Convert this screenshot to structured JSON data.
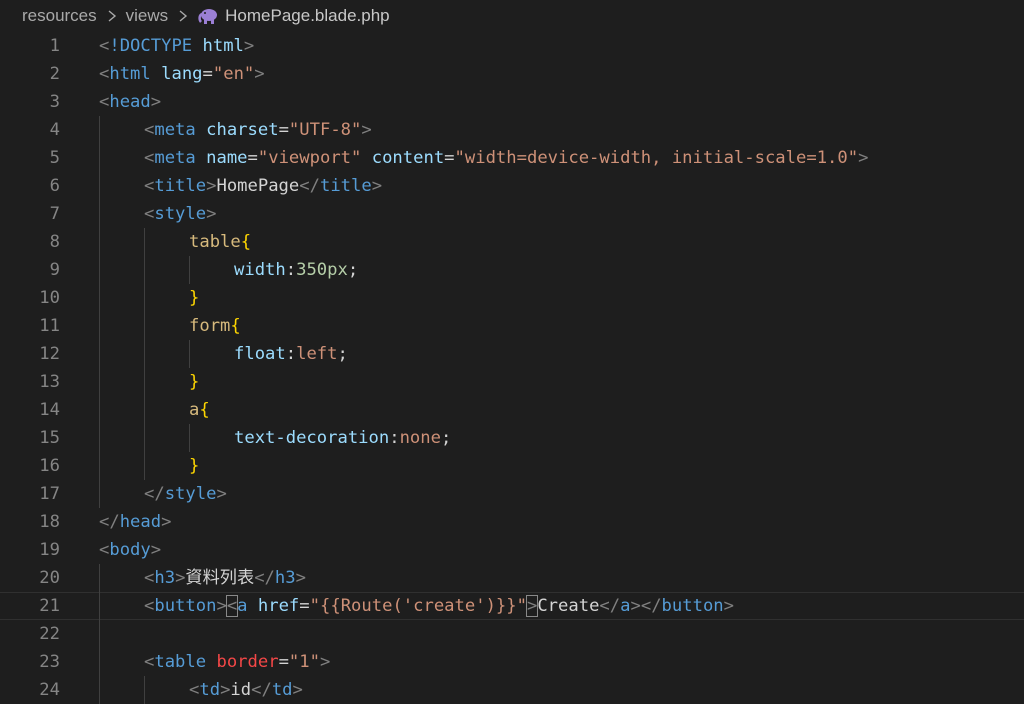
{
  "breadcrumb": {
    "parts": [
      "resources",
      "views"
    ],
    "file": "HomePage.blade.php",
    "file_icon": "php-elephant-icon"
  },
  "colors": {
    "background": "#1e1e1e",
    "tag": "#569cd6",
    "attribute": "#9cdcfe",
    "string": "#ce9178",
    "selector": "#d7ba7d",
    "number": "#b5cea8",
    "line_number": "#858585"
  },
  "current_line": 21,
  "lines": [
    {
      "n": "1",
      "indent": 0,
      "tokens": [
        [
          "pun",
          "<"
        ],
        [
          "tag",
          "!DOCTYPE"
        ],
        [
          "txt",
          " "
        ],
        [
          "attr",
          "html"
        ],
        [
          "pun",
          ">"
        ]
      ]
    },
    {
      "n": "2",
      "indent": 0,
      "tokens": [
        [
          "pun",
          "<"
        ],
        [
          "tag",
          "html"
        ],
        [
          "txt",
          " "
        ],
        [
          "attr",
          "lang"
        ],
        [
          "txt",
          "="
        ],
        [
          "str",
          "\"en\""
        ],
        [
          "pun",
          ">"
        ]
      ]
    },
    {
      "n": "3",
      "indent": 0,
      "tokens": [
        [
          "pun",
          "<"
        ],
        [
          "tag",
          "head"
        ],
        [
          "pun",
          ">"
        ]
      ]
    },
    {
      "n": "4",
      "indent": 1,
      "tokens": [
        [
          "pun",
          "<"
        ],
        [
          "tag",
          "meta"
        ],
        [
          "txt",
          " "
        ],
        [
          "attr",
          "charset"
        ],
        [
          "txt",
          "="
        ],
        [
          "str",
          "\"UTF-8\""
        ],
        [
          "pun",
          ">"
        ]
      ]
    },
    {
      "n": "5",
      "indent": 1,
      "tokens": [
        [
          "pun",
          "<"
        ],
        [
          "tag",
          "meta"
        ],
        [
          "txt",
          " "
        ],
        [
          "attr",
          "name"
        ],
        [
          "txt",
          "="
        ],
        [
          "str",
          "\"viewport\""
        ],
        [
          "txt",
          " "
        ],
        [
          "attr",
          "content"
        ],
        [
          "txt",
          "="
        ],
        [
          "str",
          "\"width=device-width, initial-scale=1.0\""
        ],
        [
          "pun",
          ">"
        ]
      ]
    },
    {
      "n": "6",
      "indent": 1,
      "tokens": [
        [
          "pun",
          "<"
        ],
        [
          "tag",
          "title"
        ],
        [
          "pun",
          ">"
        ],
        [
          "txt",
          "HomePage"
        ],
        [
          "pun",
          "</"
        ],
        [
          "tag",
          "title"
        ],
        [
          "pun",
          ">"
        ]
      ]
    },
    {
      "n": "7",
      "indent": 1,
      "tokens": [
        [
          "pun",
          "<"
        ],
        [
          "tag",
          "style"
        ],
        [
          "pun",
          ">"
        ]
      ]
    },
    {
      "n": "8",
      "indent": 2,
      "tokens": [
        [
          "sel",
          "table"
        ],
        [
          "brace",
          "{"
        ]
      ]
    },
    {
      "n": "9",
      "indent": 3,
      "tokens": [
        [
          "prop",
          "width"
        ],
        [
          "txt",
          ":"
        ],
        [
          "num",
          "350px"
        ],
        [
          "txt",
          ";"
        ]
      ]
    },
    {
      "n": "10",
      "indent": 2,
      "tokens": [
        [
          "brace",
          "}"
        ]
      ]
    },
    {
      "n": "11",
      "indent": 2,
      "tokens": [
        [
          "sel",
          "form"
        ],
        [
          "brace",
          "{"
        ]
      ]
    },
    {
      "n": "12",
      "indent": 3,
      "tokens": [
        [
          "prop",
          "float"
        ],
        [
          "txt",
          ":"
        ],
        [
          "val",
          "left"
        ],
        [
          "txt",
          ";"
        ]
      ]
    },
    {
      "n": "13",
      "indent": 2,
      "tokens": [
        [
          "brace",
          "}"
        ]
      ]
    },
    {
      "n": "14",
      "indent": 2,
      "tokens": [
        [
          "sel",
          "a"
        ],
        [
          "brace",
          "{"
        ]
      ]
    },
    {
      "n": "15",
      "indent": 3,
      "tokens": [
        [
          "prop",
          "text-decoration"
        ],
        [
          "txt",
          ":"
        ],
        [
          "val",
          "none"
        ],
        [
          "txt",
          ";"
        ]
      ]
    },
    {
      "n": "16",
      "indent": 2,
      "tokens": [
        [
          "brace",
          "}"
        ]
      ]
    },
    {
      "n": "17",
      "indent": 1,
      "tokens": [
        [
          "pun",
          "</"
        ],
        [
          "tag",
          "style"
        ],
        [
          "pun",
          ">"
        ]
      ]
    },
    {
      "n": "18",
      "indent": 0,
      "tokens": [
        [
          "pun",
          "</"
        ],
        [
          "tag",
          "head"
        ],
        [
          "pun",
          ">"
        ]
      ]
    },
    {
      "n": "19",
      "indent": 0,
      "tokens": [
        [
          "pun",
          "<"
        ],
        [
          "tag",
          "body"
        ],
        [
          "pun",
          ">"
        ]
      ]
    },
    {
      "n": "20",
      "indent": 1,
      "tokens": [
        [
          "pun",
          "<"
        ],
        [
          "tag",
          "h3"
        ],
        [
          "pun",
          ">"
        ],
        [
          "txt",
          "資料列表"
        ],
        [
          "pun",
          "</"
        ],
        [
          "tag",
          "h3"
        ],
        [
          "pun",
          ">"
        ]
      ]
    },
    {
      "n": "21",
      "indent": 1,
      "tokens": [
        [
          "pun",
          "<"
        ],
        [
          "tag",
          "button"
        ],
        [
          "pun",
          ">"
        ],
        [
          "pun",
          "<",
          "box"
        ],
        [
          "tag",
          "a"
        ],
        [
          "txt",
          " "
        ],
        [
          "attr",
          "href"
        ],
        [
          "txt",
          "="
        ],
        [
          "str",
          "\"{{Route('create')}}\""
        ],
        [
          "pun",
          ">",
          "box"
        ],
        [
          "txt",
          "Create"
        ],
        [
          "pun",
          "</"
        ],
        [
          "tag",
          "a"
        ],
        [
          "pun",
          ">"
        ],
        [
          "pun",
          "</"
        ],
        [
          "tag",
          "button"
        ],
        [
          "pun",
          ">"
        ]
      ]
    },
    {
      "n": "22",
      "indent": 0,
      "tokens": []
    },
    {
      "n": "23",
      "indent": 1,
      "tokens": [
        [
          "pun",
          "<"
        ],
        [
          "tag",
          "table"
        ],
        [
          "txt",
          " "
        ],
        [
          "redattr",
          "border"
        ],
        [
          "txt",
          "="
        ],
        [
          "str",
          "\"1\""
        ],
        [
          "pun",
          ">"
        ]
      ]
    },
    {
      "n": "24",
      "indent": 2,
      "tokens": [
        [
          "pun",
          "<"
        ],
        [
          "tag",
          "td"
        ],
        [
          "pun",
          ">"
        ],
        [
          "txt",
          "id"
        ],
        [
          "pun",
          "</"
        ],
        [
          "tag",
          "td"
        ],
        [
          "pun",
          ">"
        ]
      ]
    }
  ]
}
